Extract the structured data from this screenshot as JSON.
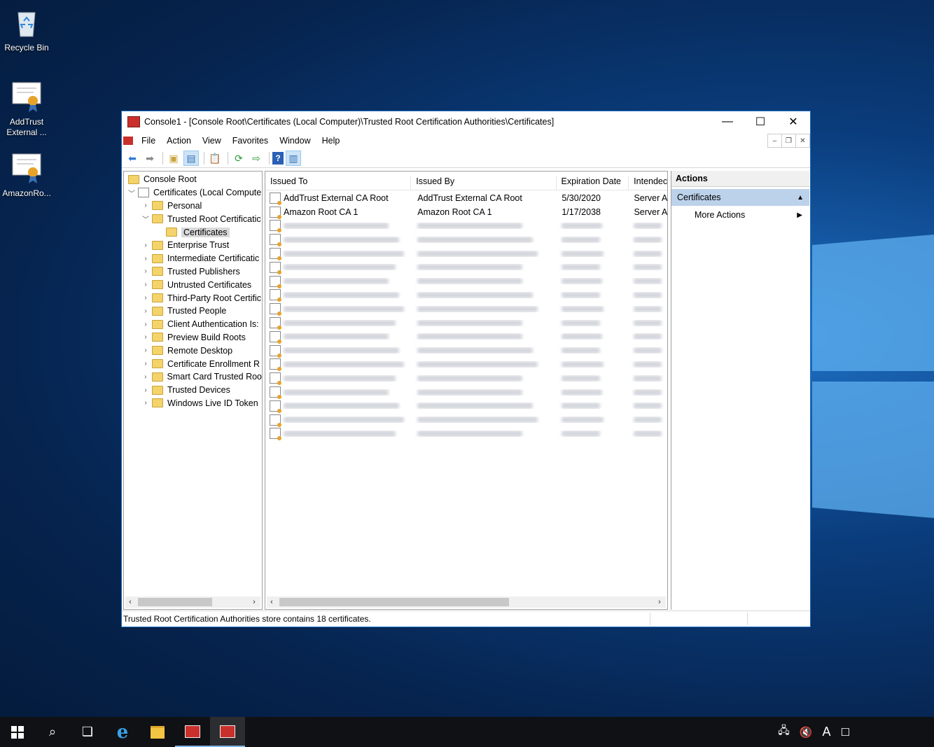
{
  "desktop": {
    "icons": [
      {
        "label": "Recycle Bin"
      },
      {
        "label": "AddTrust External ..."
      },
      {
        "label": "AmazonRo..."
      }
    ]
  },
  "window": {
    "title": "Console1 - [Console Root\\Certificates (Local Computer)\\Trusted Root Certification Authorities\\Certificates]",
    "menu": [
      "File",
      "Action",
      "View",
      "Favorites",
      "Window",
      "Help"
    ],
    "accent": "#1f6fc4"
  },
  "tree": {
    "root": "Console Root",
    "store": "Certificates (Local Compute",
    "items": [
      {
        "label": "Personal"
      },
      {
        "label": "Trusted Root Certificatic"
      },
      {
        "label": "Certificates"
      },
      {
        "label": "Enterprise Trust"
      },
      {
        "label": "Intermediate Certificatic"
      },
      {
        "label": "Trusted Publishers"
      },
      {
        "label": "Untrusted Certificates"
      },
      {
        "label": "Third-Party Root Certific"
      },
      {
        "label": "Trusted People"
      },
      {
        "label": "Client Authentication Is:"
      },
      {
        "label": "Preview Build Roots"
      },
      {
        "label": "Remote Desktop"
      },
      {
        "label": "Certificate Enrollment R"
      },
      {
        "label": "Smart Card Trusted Roo"
      },
      {
        "label": "Trusted Devices"
      },
      {
        "label": "Windows Live ID Token"
      }
    ]
  },
  "list": {
    "columns": [
      "Issued To",
      "Issued By",
      "Expiration Date",
      "Intendec"
    ],
    "rows": [
      [
        "AddTrust External CA Root",
        "AddTrust External CA Root",
        "5/30/2020",
        "Server A"
      ],
      [
        "Amazon Root CA 1",
        "Amazon Root CA 1",
        "1/17/2038",
        "Server A"
      ]
    ],
    "obscured_rows": 16
  },
  "actions": {
    "title": "Actions",
    "section": "Certificates",
    "items": [
      "More Actions"
    ]
  },
  "status": {
    "text": "Trusted Root Certification Authorities store contains 18 certificates."
  }
}
